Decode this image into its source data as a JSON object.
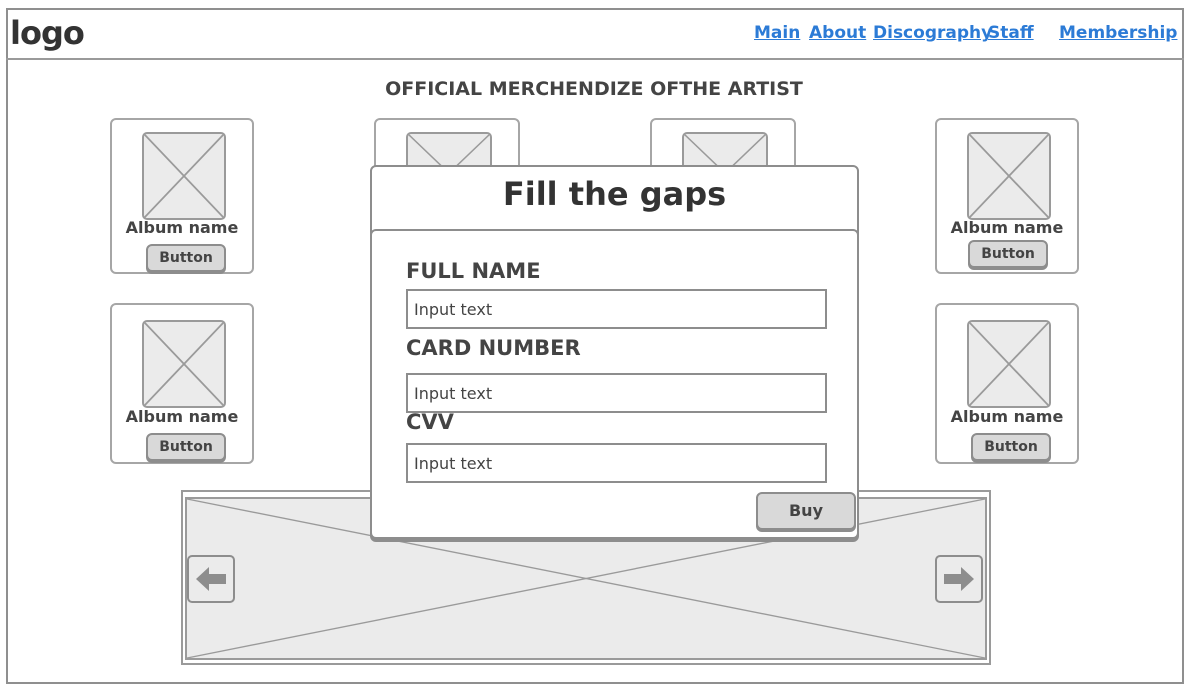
{
  "header": {
    "logo": "logo",
    "nav": [
      "Main",
      "About",
      "Discography",
      "Staff",
      "Membership"
    ]
  },
  "page_title": "OFFICIAL MERCHENDIZE OFTHE ARTIST",
  "albums": [
    {
      "name": "Album name",
      "button": "Button"
    },
    {
      "name": "Album name",
      "button": "Button"
    },
    {
      "name": "Album name",
      "button": "Button"
    },
    {
      "name": "Album name",
      "button": "Button"
    }
  ],
  "modal": {
    "title": "Fill the gaps",
    "fields": [
      {
        "label": "FULL NAME",
        "placeholder": "Input text"
      },
      {
        "label": "CARD NUMBER",
        "placeholder": "Input text"
      },
      {
        "label": "CVV",
        "placeholder": "Input text"
      }
    ],
    "buy_label": "Buy"
  },
  "icons": {
    "image_placeholder": "image-placeholder-icon",
    "prev": "arrow-left-icon",
    "next": "arrow-right-icon"
  },
  "colors": {
    "link": "#2c7bd6",
    "border": "#8d8d8d",
    "placeholder_fill": "#ebebeb",
    "button_fill": "#d9d9d9"
  }
}
